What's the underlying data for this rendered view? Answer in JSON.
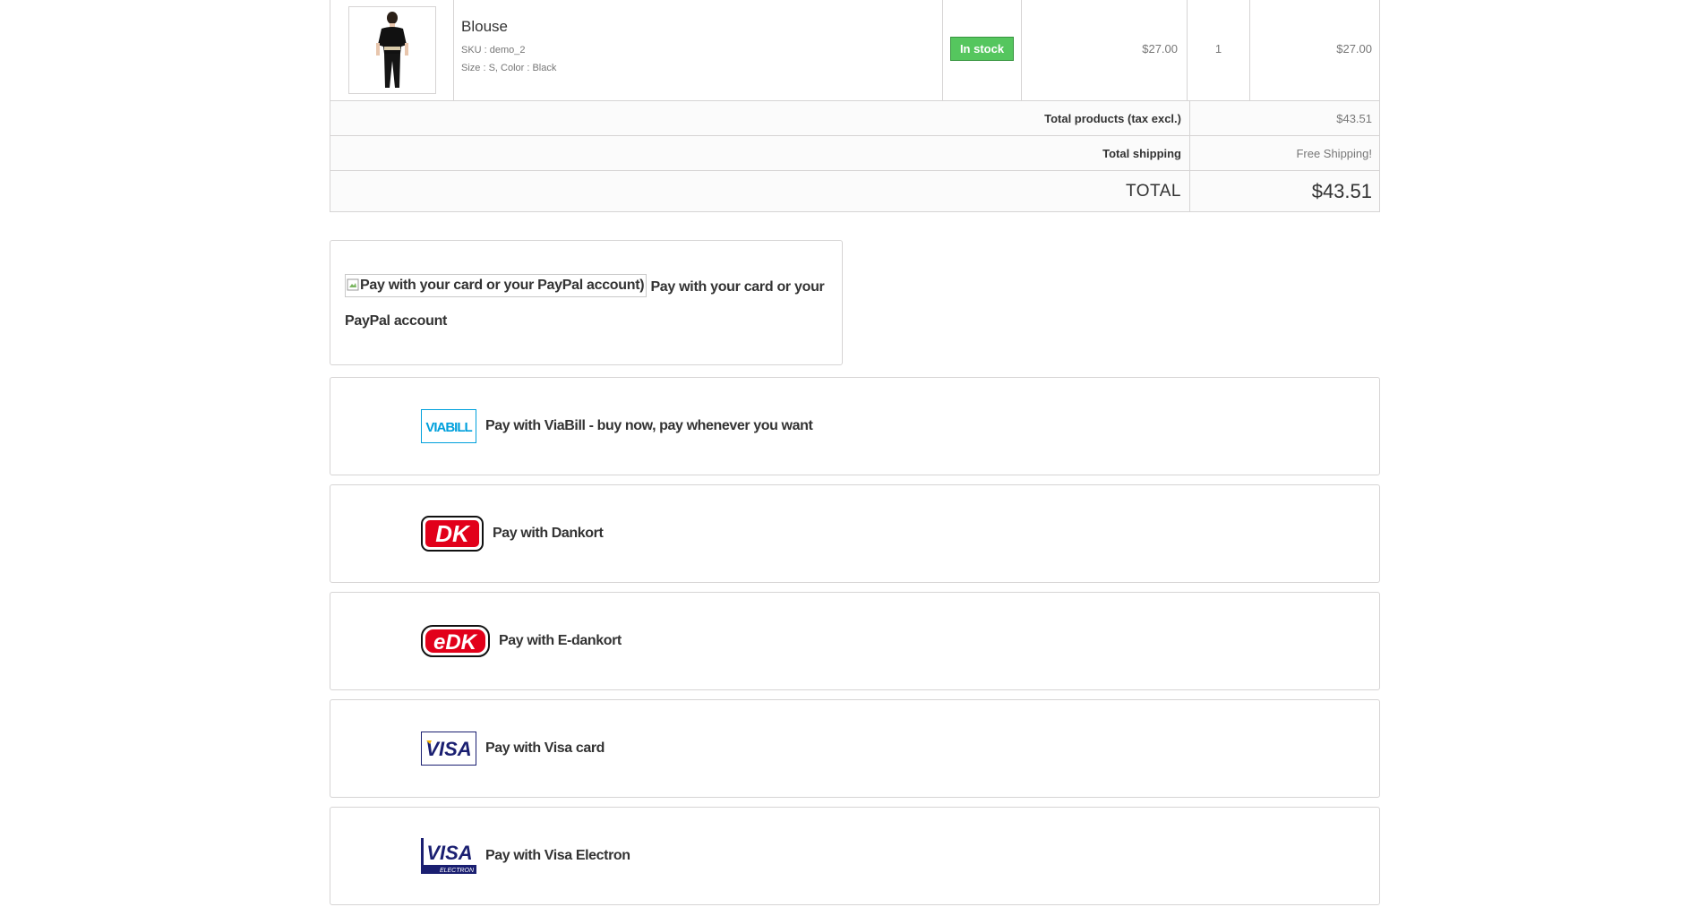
{
  "product": {
    "name": "Blouse",
    "sku": "SKU : demo_2",
    "attributes": "Size : S, Color : Black",
    "availability": "In stock",
    "unit_price": "$27.00",
    "quantity": "1",
    "total": "$27.00"
  },
  "summary": {
    "products_label": "Total products (tax excl.)",
    "products_value": "$43.51",
    "shipping_label": "Total shipping",
    "shipping_value": "Free Shipping!",
    "total_label": "TOTAL",
    "total_value": "$43.51"
  },
  "payments": {
    "paypal": {
      "img_alt": "Pay with your card or your PayPal account)",
      "label": "Pay with your card or your PayPal account"
    },
    "viabill": {
      "logo_text": "VIABILL",
      "label": "Pay with ViaBill - buy now, pay whenever you want"
    },
    "dankort": {
      "logo_text": "DK",
      "label": "Pay with Dankort"
    },
    "edankort": {
      "logo_text": "eDK",
      "label": "Pay with E-dankort"
    },
    "visa": {
      "logo_text": "VISA",
      "label": "Pay with Visa card"
    },
    "visa_electron": {
      "logo_text": "VISA",
      "logo_sub": "ELECTRON",
      "label": "Pay with Visa Electron"
    }
  },
  "colors": {
    "in_stock": "#55c65e",
    "border": "#d6d4d4",
    "dankort_red": "#e2001a",
    "visa_blue": "#1a1f71",
    "viabill_blue": "#00a0dc"
  }
}
